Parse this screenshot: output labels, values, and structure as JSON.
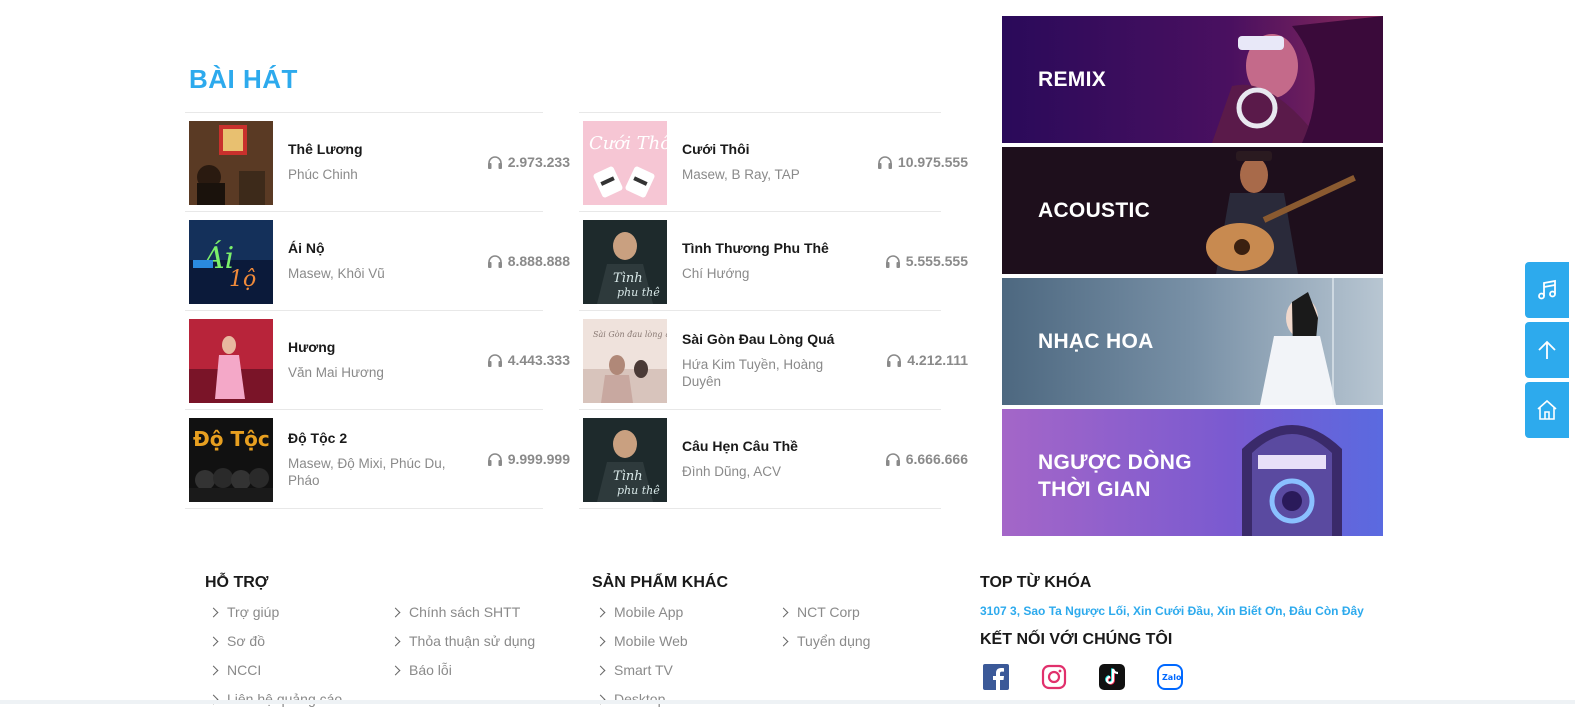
{
  "section": {
    "title": "BÀI HÁT"
  },
  "songs_left": [
    {
      "title": "Thê Lương",
      "artist": "Phúc Chinh",
      "listens": "2.973.233"
    },
    {
      "title": "Ái Nộ",
      "artist": "Masew, Khôi Vũ",
      "listens": "8.888.888"
    },
    {
      "title": "Hương",
      "artist": "Văn Mai Hương",
      "listens": "4.443.333"
    },
    {
      "title": "Độ Tộc 2",
      "artist": "Masew, Độ Mixi, Phúc Du, Pháo",
      "listens": "9.999.999"
    }
  ],
  "songs_right": [
    {
      "title": "Cưới Thôi",
      "artist": "Masew, B Ray, TAP",
      "listens": "10.975.555"
    },
    {
      "title": "Tình Thương Phu Thê",
      "artist": "Chí Hướng",
      "listens": "5.555.555"
    },
    {
      "title": "Sài Gòn Đau Lòng Quá",
      "artist": "Hứa Kim Tuyền, Hoàng Duyên",
      "listens": "4.212.111"
    },
    {
      "title": "Câu Hẹn Câu Thề",
      "artist": "Đình Dũng, ACV",
      "listens": "6.666.666"
    }
  ],
  "banners": [
    {
      "label": "REMIX",
      "color": "#3a0f5e"
    },
    {
      "label": "ACOUSTIC",
      "color": "#1e0f1c"
    },
    {
      "label": "NHẠC HOA",
      "color": "#5d7a92"
    },
    {
      "label": "NGƯỢC DÒNG\nTHỜI GIAN",
      "color": "#8a5fd0"
    }
  ],
  "side_buttons": [
    {
      "icon": "music-note-icon"
    },
    {
      "icon": "arrow-up-icon"
    },
    {
      "icon": "home-icon"
    }
  ],
  "footer": {
    "support": {
      "title": "HỖ TRỢ",
      "links_col1": [
        "Trợ giúp",
        "Sơ đồ",
        "NCCI",
        "Liên hệ quảng cáo"
      ],
      "links_col2": [
        "Chính sách SHTT",
        "Thỏa thuận sử dụng",
        "Báo lỗi"
      ]
    },
    "products": {
      "title": "SẢN PHẨM KHÁC",
      "links_col1": [
        "Mobile App",
        "Mobile Web",
        "Smart TV",
        "Desktop"
      ],
      "links_col2": [
        "NCT Corp",
        "Tuyển dụng"
      ]
    },
    "keywords": {
      "title": "TOP TỪ KHÓA",
      "text": "3107 3, Sao Ta Ngược Lối, Xin Cưới Đầu, Xin Biết Ơn, Đâu Còn Đây"
    },
    "connect": {
      "title": "KẾT NỐI VỚI CHÚNG TÔI",
      "socials": [
        "facebook-icon",
        "instagram-icon",
        "tiktok-icon",
        "zalo-icon"
      ],
      "zalo_text": "Zalo"
    }
  },
  "colors": {
    "accent": "#2daaed",
    "muted": "#8a8a8a"
  }
}
